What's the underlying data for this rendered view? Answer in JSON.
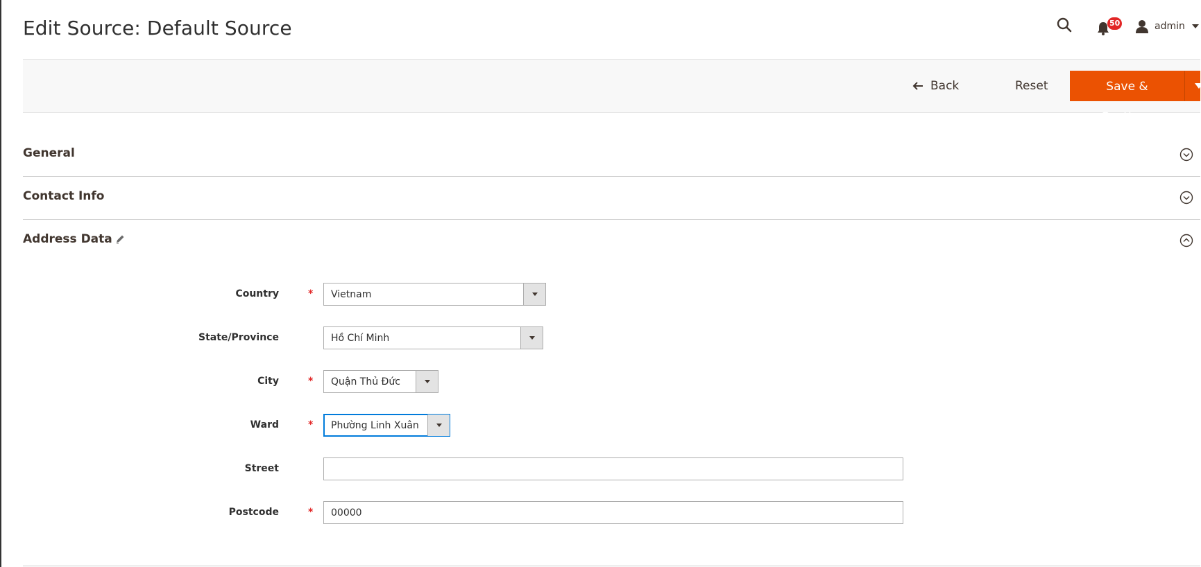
{
  "header": {
    "title": "Edit Source: Default Source",
    "notifications_count": "50",
    "user_name": "admin"
  },
  "toolbar": {
    "back_label": "Back",
    "reset_label": "Reset",
    "save_label": "Save & Continue"
  },
  "sections": {
    "general": "General",
    "contact_info": "Contact Info",
    "address_data": "Address Data"
  },
  "form": {
    "country": {
      "label": "Country",
      "value": "Vietnam",
      "required": "*"
    },
    "state": {
      "label": "State/Province",
      "value": "Hồ Chí Minh"
    },
    "city": {
      "label": "City",
      "value": "Quận Thủ Đức",
      "required": "*"
    },
    "ward": {
      "label": "Ward",
      "value": "Phường Linh Xuân",
      "required": "*"
    },
    "street": {
      "label": "Street",
      "value": ""
    },
    "postcode": {
      "label": "Postcode",
      "value": "00000",
      "required": "*"
    }
  },
  "colors": {
    "accent": "#eb5202",
    "badge": "#e22626",
    "focus": "#007bdb",
    "required": "#e22626"
  }
}
